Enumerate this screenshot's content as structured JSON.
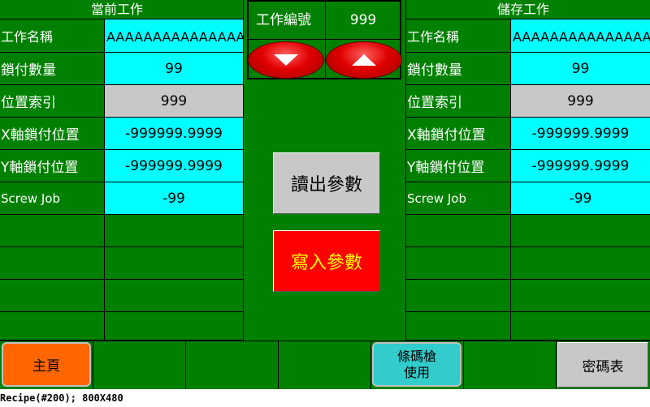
{
  "left_panel": {
    "title": "當前工作",
    "rows": [
      {
        "label": "工作名稱",
        "value": "AAAAAAAAAAAAAAAAAAAA"
      },
      {
        "label": "鎖付數量",
        "value": "99"
      },
      {
        "label": "位置索引",
        "value": "999"
      },
      {
        "label": "X軸鎖付位置",
        "value": "-999999.9999"
      },
      {
        "label": "Y軸鎖付位置",
        "value": "-999999.9999"
      },
      {
        "label": "Screw Job",
        "value": "-99"
      }
    ]
  },
  "right_panel": {
    "title": "儲存工作",
    "rows": [
      {
        "label": "工作名稱",
        "value": "AAAAAAAAAAAAAAAAAAAA"
      },
      {
        "label": "鎖付數量",
        "value": "99"
      },
      {
        "label": "位置索引",
        "value": "999"
      },
      {
        "label": "X軸鎖付位置",
        "value": "-999999.9999"
      },
      {
        "label": "Y軸鎖付位置",
        "value": "-999999.9999"
      },
      {
        "label": "Screw Job",
        "value": "-99"
      }
    ]
  },
  "job_selector": {
    "label": "工作編號",
    "value": "999"
  },
  "actions": {
    "read_label": "讀出參數",
    "write_label": "寫入參數"
  },
  "bottom_bar": {
    "home_label": "主頁",
    "barcode_line1": "條碼槍",
    "barcode_line2": "使用",
    "password_label": "密碼表"
  },
  "footer_text": "Recipe(#200); 800X480",
  "colors": {
    "background": "#008000",
    "value_cell": "#00ffff",
    "index_cell": "#c8c8c8",
    "write_button": "#ff0000",
    "home_button": "#ff6600",
    "barcode_button": "#33cccc"
  }
}
